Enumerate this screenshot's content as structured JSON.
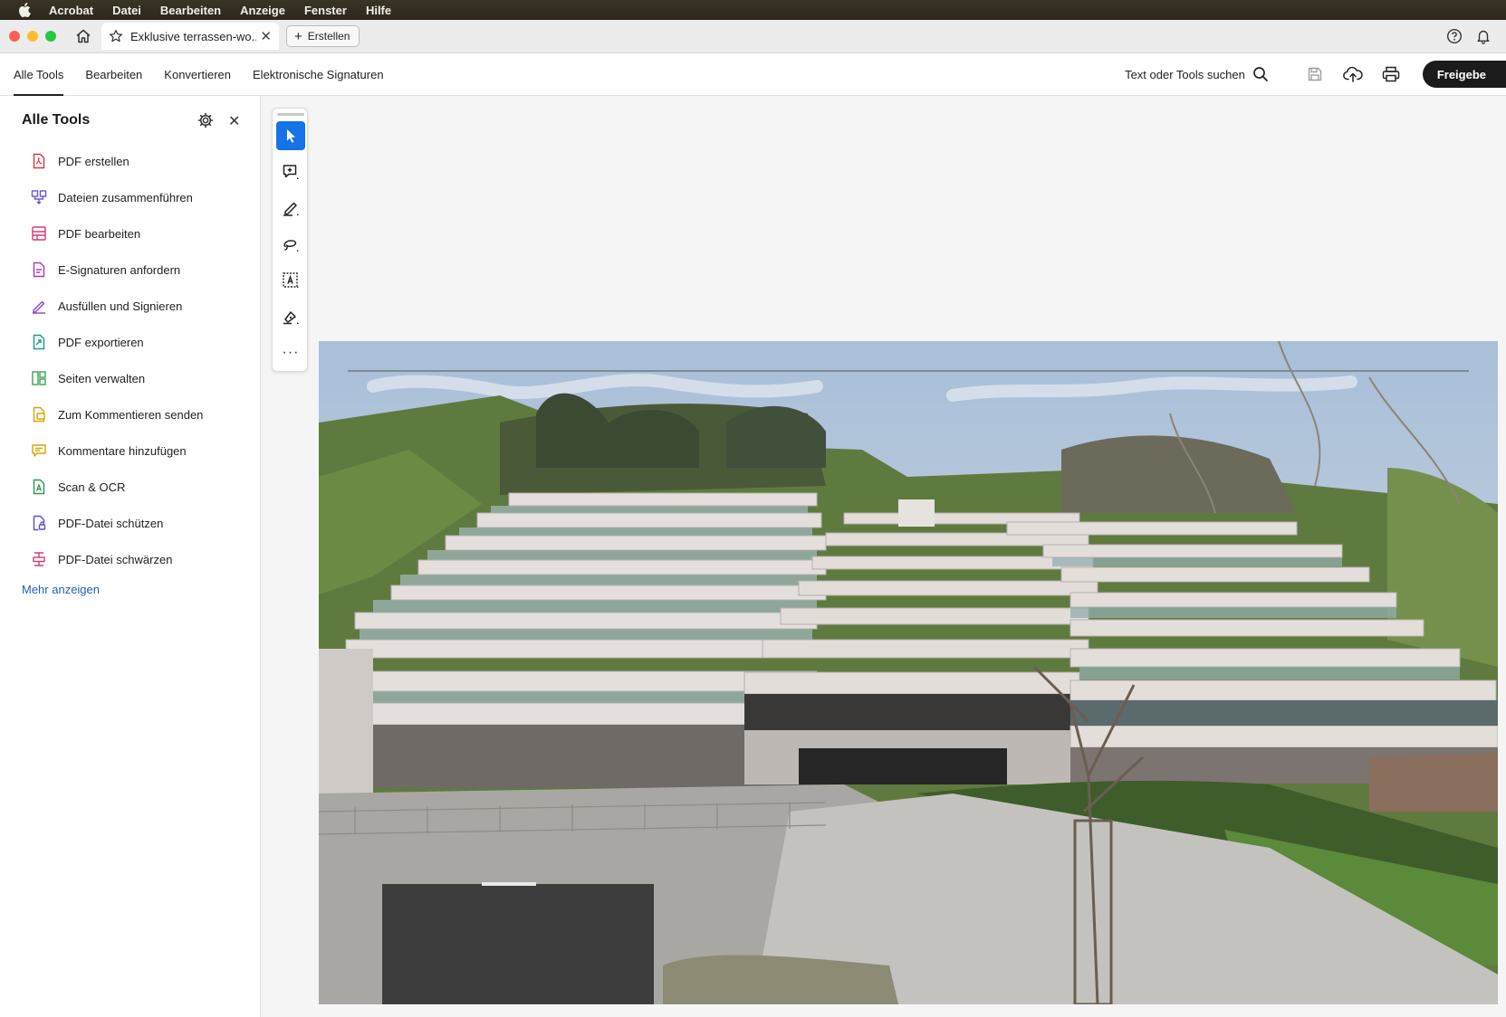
{
  "menubar": {
    "items": [
      "Acrobat",
      "Datei",
      "Bearbeiten",
      "Anzeige",
      "Fenster",
      "Hilfe"
    ]
  },
  "tabbar": {
    "doc_title": "Exklusive terrassen-wo...",
    "create_label": "Erstellen"
  },
  "toolbar": {
    "tabs": [
      "Alle Tools",
      "Bearbeiten",
      "Konvertieren",
      "Elektronische Signaturen"
    ],
    "search_label": "Text oder Tools suchen",
    "share_label": "Freigebe"
  },
  "sidebar": {
    "title": "Alle Tools",
    "items": [
      {
        "label": "PDF erstellen",
        "color": "#d7373f"
      },
      {
        "label": "Dateien zusammenführen",
        "color": "#6e55d4"
      },
      {
        "label": "PDF bearbeiten",
        "color": "#d23b78"
      },
      {
        "label": "E-Signaturen anfordern",
        "color": "#b035b8"
      },
      {
        "label": "Ausfüllen und Signieren",
        "color": "#8a44c9"
      },
      {
        "label": "PDF exportieren",
        "color": "#1a9b8e"
      },
      {
        "label": "Seiten verwalten",
        "color": "#3aa64a"
      },
      {
        "label": "Zum Kommentieren senden",
        "color": "#d9a400"
      },
      {
        "label": "Kommentare hinzufügen",
        "color": "#d9a400"
      },
      {
        "label": "Scan & OCR",
        "color": "#2e9a4a"
      },
      {
        "label": "PDF-Datei schützen",
        "color": "#5a4fd0"
      },
      {
        "label": "PDF-Datei schwärzen",
        "color": "#d23b78"
      }
    ],
    "more_label": "Mehr anzeigen"
  },
  "colors": {
    "accent": "#1473e6",
    "link": "#1c64b8"
  }
}
